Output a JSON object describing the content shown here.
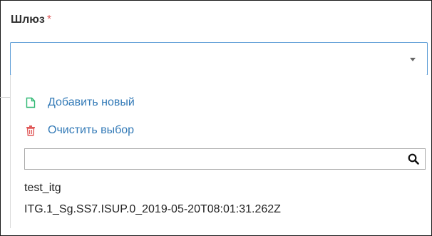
{
  "field": {
    "label": "Шлюз",
    "required_mark": "*",
    "selected_value": ""
  },
  "dropdown": {
    "actions": [
      {
        "label": "Добавить новый",
        "icon": "file-icon",
        "color": "#2eb872"
      },
      {
        "label": "Очистить выбор",
        "icon": "trash-icon",
        "color": "#e05a5a"
      }
    ],
    "search": {
      "value": "",
      "placeholder": ""
    },
    "options": [
      "test_itg",
      "ITG.1_Sg.SS7.ISUP.0_2019-05-20T08:01:31.262Z"
    ]
  },
  "colors": {
    "accent": "#5a9bd5",
    "link": "#337ab7",
    "required": "#e05a5a"
  }
}
